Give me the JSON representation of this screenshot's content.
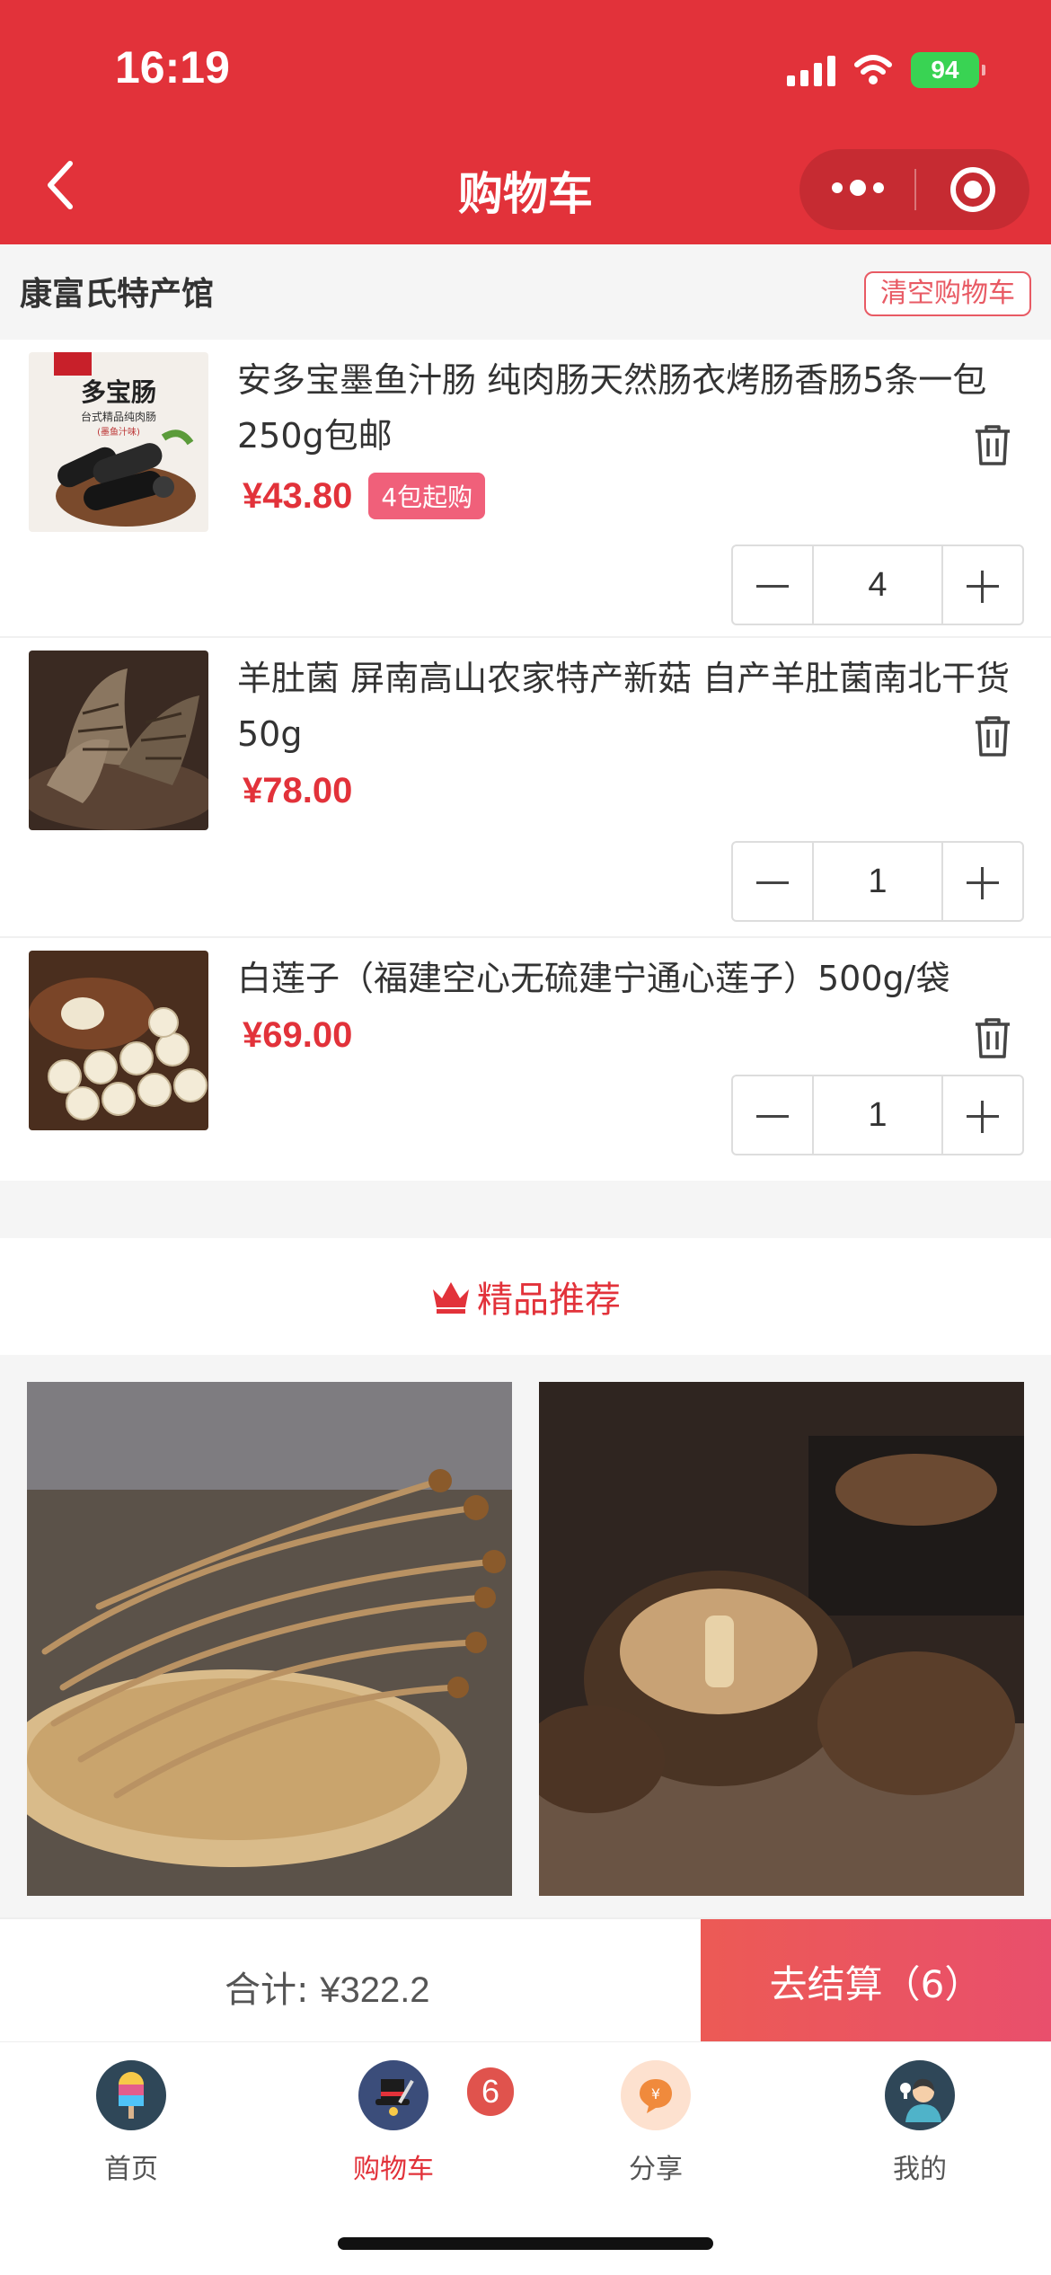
{
  "status_bar": {
    "time": "16:19",
    "battery": "94"
  },
  "nav": {
    "title": "购物车"
  },
  "store": {
    "name": "康富氏特产馆",
    "clear_label": "清空购物车"
  },
  "cart_items": [
    {
      "name": "安多宝墨鱼汁肠 纯肉肠天然肠衣烤肠香肠5条一包250g包邮",
      "price": "¥43.80",
      "badge": "4包起购",
      "qty": "4",
      "image": {
        "brand_text": "多宝肠",
        "sub_text": "台式精品纯肉肠",
        "flavor_text": "(墨鱼汁味)"
      }
    },
    {
      "name": "羊肚菌 屏南高山农家特产新菇 自产羊肚菌南北干货50g",
      "price": "¥78.00",
      "qty": "1"
    },
    {
      "name": "白莲子（福建空心无硫建宁通心莲子）500g/袋",
      "price": "¥69.00",
      "qty": "1"
    }
  ],
  "recommend": {
    "title": "精品推荐"
  },
  "checkout": {
    "total_label": "合计:",
    "total_amount": "¥322.2",
    "button_label": "去结算（6）"
  },
  "tabbar": {
    "items": [
      {
        "label": "首页",
        "icon": "home-popsicle-icon"
      },
      {
        "label": "购物车",
        "icon": "cart-magic-hat-icon",
        "badge": "6"
      },
      {
        "label": "分享",
        "icon": "share-coin-icon"
      },
      {
        "label": "我的",
        "icon": "profile-avatar-icon"
      }
    ]
  },
  "colors": {
    "brand_red": "#e2323a",
    "price_red": "#e2323a",
    "badge_pink": "#f0607a"
  }
}
